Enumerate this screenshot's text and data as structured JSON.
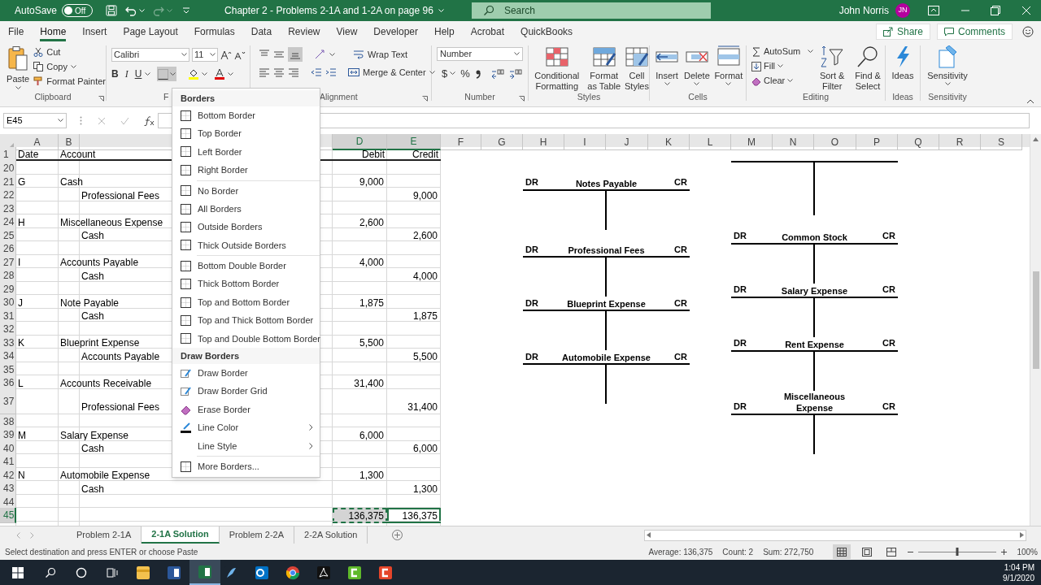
{
  "title_bar": {
    "autosave_label": "AutoSave",
    "autosave_on": false,
    "autosave_state": "Off",
    "title": "Chapter 2 - Problems 2-1A and 1-2A on page 96",
    "search_placeholder": "Search",
    "user_name": "John Norris",
    "user_initials": "JN"
  },
  "menu_tabs": [
    {
      "label": "File",
      "selected": false
    },
    {
      "label": "Home",
      "selected": true
    },
    {
      "label": "Insert",
      "selected": false
    },
    {
      "label": "Page Layout",
      "selected": false
    },
    {
      "label": "Formulas",
      "selected": false
    },
    {
      "label": "Data",
      "selected": false
    },
    {
      "label": "Review",
      "selected": false
    },
    {
      "label": "View",
      "selected": false
    },
    {
      "label": "Developer",
      "selected": false
    },
    {
      "label": "Help",
      "selected": false
    },
    {
      "label": "Acrobat",
      "selected": false
    },
    {
      "label": "QuickBooks",
      "selected": false
    }
  ],
  "share_button": "Share",
  "comments_button": "Comments",
  "ribbon": {
    "clipboard": {
      "paste": "Paste",
      "cut": "Cut",
      "copy": "Copy",
      "format_painter": "Format Painter",
      "label": "Clipboard"
    },
    "font": {
      "font_name": "Calibri",
      "font_size": "11",
      "bold": "B",
      "italic": "I",
      "underline": "U",
      "label": "F"
    },
    "alignment": {
      "bottom_align_selected": true,
      "wrap_text": "Wrap Text",
      "merge_center": "Merge & Center",
      "label": "Alignment"
    },
    "number": {
      "format": "Number",
      "currency": "$",
      "percent": "%",
      "label": "Number"
    },
    "styles": {
      "conditional_formatting": "Conditional Formatting",
      "format_as_table": "Format as Table",
      "cell_styles": "Cell Styles",
      "label": "Styles"
    },
    "cells": {
      "insert": "Insert",
      "delete": "Delete",
      "format": "Format",
      "label": "Cells"
    },
    "editing": {
      "autosum": "AutoSum",
      "fill": "Fill",
      "clear": "Clear",
      "sort_filter": "Sort & Filter",
      "find_select": "Find & Select",
      "label": "Editing"
    },
    "ideas": {
      "ideas": "Ideas",
      "label": "Ideas"
    },
    "sensitivity": {
      "sensitivity": "Sensitivity",
      "label": "Sensitivity"
    }
  },
  "borders_menu": {
    "open": true,
    "items": [
      {
        "kind": "header",
        "label": "Borders"
      },
      {
        "kind": "border",
        "label": "Bottom Border"
      },
      {
        "kind": "border",
        "label": "Top Border"
      },
      {
        "kind": "border",
        "label": "Left Border"
      },
      {
        "kind": "border",
        "label": "Right Border"
      },
      {
        "kind": "separator"
      },
      {
        "kind": "border",
        "label": "No Border"
      },
      {
        "kind": "border",
        "label": "All Borders"
      },
      {
        "kind": "border",
        "label": "Outside Borders"
      },
      {
        "kind": "border",
        "label": "Thick Outside Borders"
      },
      {
        "kind": "separator"
      },
      {
        "kind": "border",
        "label": "Bottom Double Border"
      },
      {
        "kind": "border",
        "label": "Thick Bottom Border"
      },
      {
        "kind": "border",
        "label": "Top and Bottom Border"
      },
      {
        "kind": "border",
        "label": "Top and Thick Bottom Border"
      },
      {
        "kind": "border",
        "label": "Top and Double Bottom Border"
      },
      {
        "kind": "header",
        "label": "Draw Borders"
      },
      {
        "kind": "pencil",
        "label": "Draw Border"
      },
      {
        "kind": "pencil",
        "label": "Draw Border Grid"
      },
      {
        "kind": "eraser",
        "label": "Erase Border"
      },
      {
        "kind": "color",
        "label": "Line Color",
        "submenu": true
      },
      {
        "kind": "plain",
        "label": "Line Style",
        "submenu": true
      },
      {
        "kind": "separator"
      },
      {
        "kind": "border",
        "label": "More Borders..."
      }
    ]
  },
  "formula_bar": {
    "name_box": "E45"
  },
  "sheet": {
    "columns": [
      {
        "letter": "A",
        "selected": false
      },
      {
        "letter": "B",
        "selected": false
      },
      {
        "selected": false
      },
      {
        "letter": "D",
        "selected": true
      },
      {
        "letter": "E",
        "selected": true
      },
      {
        "letter": "F",
        "selected": false
      },
      {
        "letter": "G",
        "selected": false
      },
      {
        "letter": "H",
        "selected": false
      },
      {
        "letter": "I",
        "selected": false
      },
      {
        "letter": "J",
        "selected": false
      },
      {
        "letter": "K",
        "selected": false
      },
      {
        "letter": "L",
        "selected": false
      },
      {
        "letter": "M",
        "selected": false
      },
      {
        "letter": "N",
        "selected": false
      },
      {
        "letter": "O",
        "selected": false
      },
      {
        "letter": "P",
        "selected": false
      },
      {
        "letter": "Q",
        "selected": false
      },
      {
        "letter": "R",
        "selected": false
      },
      {
        "letter": "S",
        "selected": false
      }
    ],
    "header_row": {
      "number": "1",
      "date": "Date",
      "account": "Account",
      "debit": "Debit",
      "credit": "Credit"
    },
    "rows": [
      {
        "number": "20",
        "selected": false,
        "right_t": {
          "kind": "stem"
        }
      },
      {
        "number": "21",
        "selected": false,
        "date": "G",
        "account": "Cash",
        "debit": "9,000",
        "left_t": {
          "kind": "header",
          "dr": "DR",
          "title": "Notes Payable",
          "cr": "CR"
        }
      },
      {
        "number": "22",
        "selected": false,
        "sub_account": "Professional Fees",
        "credit": "9,000"
      },
      {
        "number": "23",
        "selected": false
      },
      {
        "number": "24",
        "selected": false,
        "date": "H",
        "account": "Miscellaneous Expense",
        "debit": "2,600"
      },
      {
        "number": "25",
        "selected": false,
        "sub_account": "Cash",
        "credit": "2,600",
        "right_t": {
          "kind": "header",
          "dr": "DR",
          "title": "Common Stock",
          "cr": "CR"
        }
      },
      {
        "number": "26",
        "selected": false,
        "left_t": {
          "kind": "header",
          "dr": "DR",
          "title": "Professional Fees",
          "cr": "CR"
        }
      },
      {
        "number": "27",
        "selected": false,
        "date": "I",
        "account": "Accounts Payable",
        "debit": "4,000"
      },
      {
        "number": "28",
        "selected": false,
        "sub_account": "Cash",
        "credit": "4,000"
      },
      {
        "number": "29",
        "selected": false,
        "right_t": {
          "kind": "header",
          "dr": "DR",
          "title": "Salary Expense",
          "cr": "CR"
        }
      },
      {
        "number": "30",
        "selected": false,
        "date": "J",
        "account": "Note Payable",
        "debit": "1,875",
        "left_t": {
          "kind": "header",
          "dr": "DR",
          "title": "Blueprint Expense",
          "cr": "CR"
        }
      },
      {
        "number": "31",
        "selected": false,
        "sub_account": "Cash",
        "credit": "1,875"
      },
      {
        "number": "32",
        "selected": false
      },
      {
        "number": "33",
        "selected": false,
        "date": "K",
        "account": "Blueprint Expense",
        "debit": "5,500",
        "right_t": {
          "kind": "header",
          "dr": "DR",
          "title": "Rent Expense",
          "cr": "CR"
        }
      },
      {
        "number": "34",
        "selected": false,
        "sub_account": "Accounts Payable",
        "credit": "5,500",
        "left_t": {
          "kind": "header",
          "dr": "DR",
          "title": "Automobile Expense",
          "cr": "CR"
        }
      },
      {
        "number": "35",
        "selected": false
      },
      {
        "number": "36",
        "selected": false,
        "date": "L",
        "account": "Accounts Receivable",
        "debit": "31,400"
      },
      {
        "number": "37",
        "selected": false,
        "tall": true,
        "sub_account": "Professional Fees",
        "credit": "31,400",
        "right_t": {
          "kind": "header",
          "dr": "DR",
          "title": "Miscellaneous Expense",
          "cr": "CR"
        }
      },
      {
        "number": "38",
        "selected": false
      },
      {
        "number": "39",
        "selected": false,
        "date": "M",
        "account": "Salary Expense",
        "debit": "6,000"
      },
      {
        "number": "40",
        "selected": false,
        "sub_account": "Cash",
        "credit": "6,000"
      },
      {
        "number": "41",
        "selected": false
      },
      {
        "number": "42",
        "selected": false,
        "date": "N",
        "account": "Automobile Expense",
        "debit": "1,300"
      },
      {
        "number": "43",
        "selected": false,
        "sub_account": "Cash",
        "credit": "1,300"
      },
      {
        "number": "44",
        "selected": false
      },
      {
        "number": "45",
        "selected": true,
        "debit": "136,375",
        "credit": "136,375"
      }
    ]
  },
  "sheet_tabs": [
    {
      "label": "Problem 2-1A",
      "selected": false
    },
    {
      "label": "2-1A Solution",
      "selected": true
    },
    {
      "label": "Problem 2-2A",
      "selected": false
    },
    {
      "label": "2-2A Solution",
      "selected": false
    }
  ],
  "status_bar": {
    "message": "Select destination and press ENTER or choose Paste",
    "average": "Average: 136,375",
    "count": "Count: 2",
    "sum": "Sum: 272,750",
    "zoom_slider": {
      "level": 0.5
    },
    "zoom": "100%"
  },
  "taskbar": {
    "time": "1:04 PM",
    "date": "9/1/2020"
  }
}
